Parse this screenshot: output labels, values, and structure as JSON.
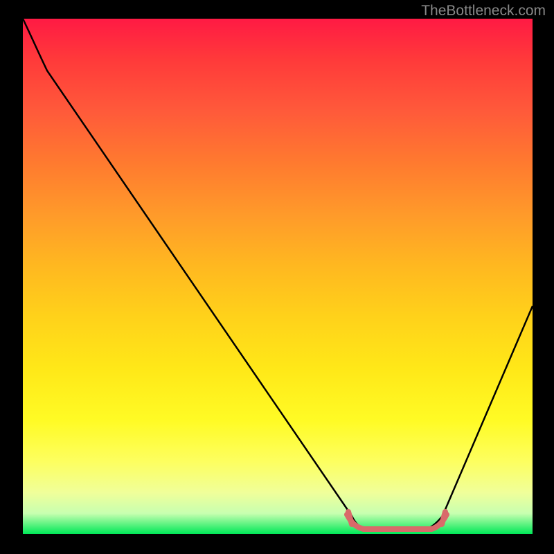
{
  "watermark": "TheBottleneck.com",
  "chart_data": {
    "type": "line",
    "title": "",
    "xlabel": "",
    "ylabel": "",
    "xlim": [
      0,
      100
    ],
    "ylim": [
      0,
      100
    ],
    "grid": false,
    "legend": false,
    "series": [
      {
        "name": "bottleneck-curve",
        "x": [
          0,
          4,
          10,
          20,
          30,
          40,
          50,
          60,
          63,
          68,
          72,
          75,
          80,
          85,
          90,
          95,
          100
        ],
        "y": [
          100,
          95,
          88,
          75,
          62,
          49,
          36,
          15,
          4,
          0,
          0,
          0,
          0,
          4,
          16,
          30,
          45
        ],
        "color": "#000000"
      }
    ],
    "markers": [
      {
        "name": "flat-region-left-tick",
        "x": 63,
        "y": 2,
        "color": "#e06666"
      },
      {
        "name": "flat-region-right-tick",
        "x": 80,
        "y": 2,
        "color": "#e06666"
      }
    ],
    "background_gradient": {
      "top": "#ff1a44",
      "middle": "#ffe818",
      "bottom": "#00e858"
    }
  }
}
